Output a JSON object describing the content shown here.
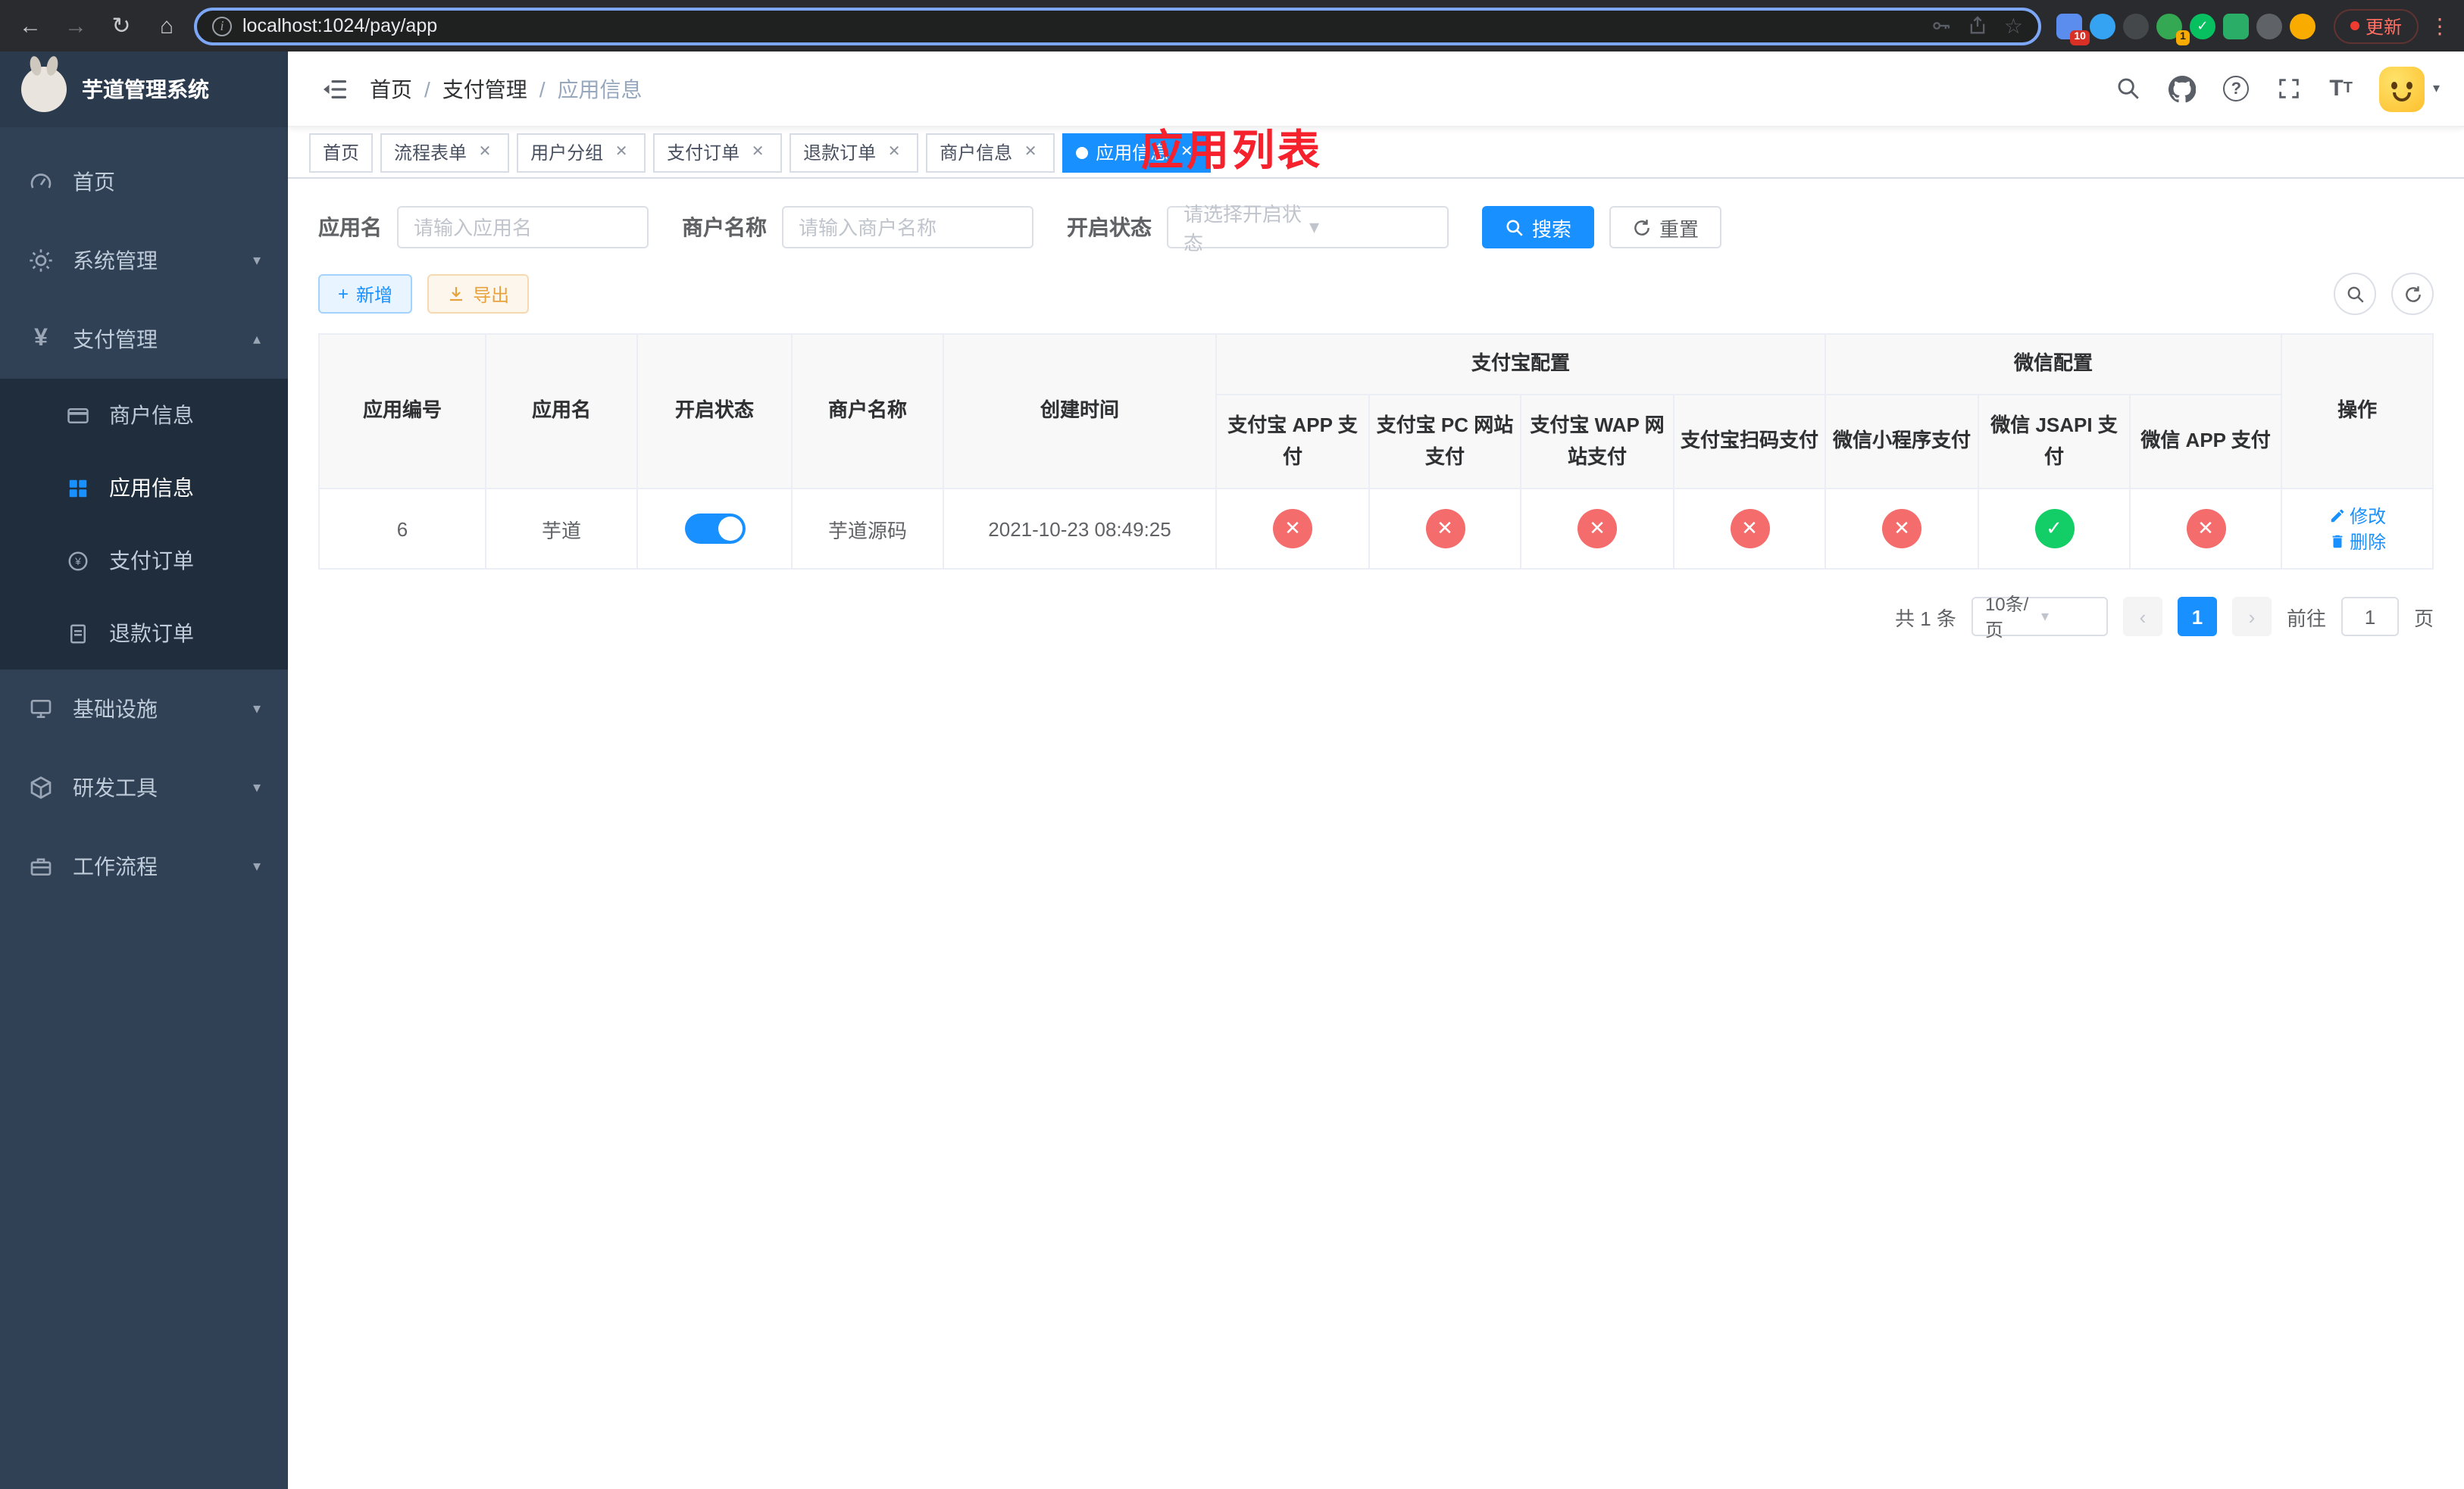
{
  "browser": {
    "url": "localhost:1024/pay/app",
    "update_label": "更新",
    "ext_badge_1": "10",
    "ext_badge_2": "1"
  },
  "sidebar": {
    "logo_title": "芋道管理系统",
    "menu": [
      {
        "label": "首页"
      },
      {
        "label": "系统管理"
      },
      {
        "label": "支付管理"
      },
      {
        "label": "基础设施"
      },
      {
        "label": "研发工具"
      },
      {
        "label": "工作流程"
      }
    ],
    "payment_submenu": [
      {
        "label": "商户信息"
      },
      {
        "label": "应用信息"
      },
      {
        "label": "支付订单"
      },
      {
        "label": "退款订单"
      }
    ]
  },
  "navbar": {
    "breadcrumb": [
      "首页",
      "支付管理",
      "应用信息"
    ],
    "page_title": "应用列表"
  },
  "tabs": [
    {
      "label": "首页"
    },
    {
      "label": "流程表单"
    },
    {
      "label": "用户分组"
    },
    {
      "label": "支付订单"
    },
    {
      "label": "退款订单"
    },
    {
      "label": "商户信息"
    },
    {
      "label": "应用信息"
    }
  ],
  "filters": {
    "app_name_label": "应用名",
    "app_name_placeholder": "请输入应用名",
    "merchant_label": "商户名称",
    "merchant_placeholder": "请输入商户名称",
    "status_label": "开启状态",
    "status_placeholder": "请选择开启状态",
    "search_label": "搜索",
    "reset_label": "重置"
  },
  "toolbar": {
    "add_label": "新增",
    "export_label": "导出"
  },
  "table": {
    "headers": {
      "app_id": "应用编号",
      "app_name": "应用名",
      "status": "开启状态",
      "merchant": "商户名称",
      "create_time": "创建时间",
      "alipay_group": "支付宝配置",
      "wechat_group": "微信配置",
      "alipay_app": "支付宝 APP 支付",
      "alipay_pc": "支付宝 PC 网站支付",
      "alipay_wap": "支付宝 WAP 网站支付",
      "alipay_qr": "支付宝扫码支付",
      "wx_lite": "微信小程序支付",
      "wx_jsapi": "微信 JSAPI 支付",
      "wx_app": "微信 APP 支付",
      "actions": "操作"
    },
    "rows": [
      {
        "app_id": "6",
        "app_name": "芋道",
        "enabled": true,
        "merchant": "芋道源码",
        "create_time": "2021-10-23 08:49:25",
        "alipay_app": false,
        "alipay_pc": false,
        "alipay_wap": false,
        "alipay_qr": false,
        "wx_lite": false,
        "wx_jsapi": true,
        "wx_app": false,
        "edit_label": "修改",
        "delete_label": "删除"
      }
    ]
  },
  "pagination": {
    "total": "共 1 条",
    "page_size": "10条/页",
    "current_page": "1",
    "goto_label": "前往",
    "goto_value": "1",
    "page_unit": "页"
  }
}
